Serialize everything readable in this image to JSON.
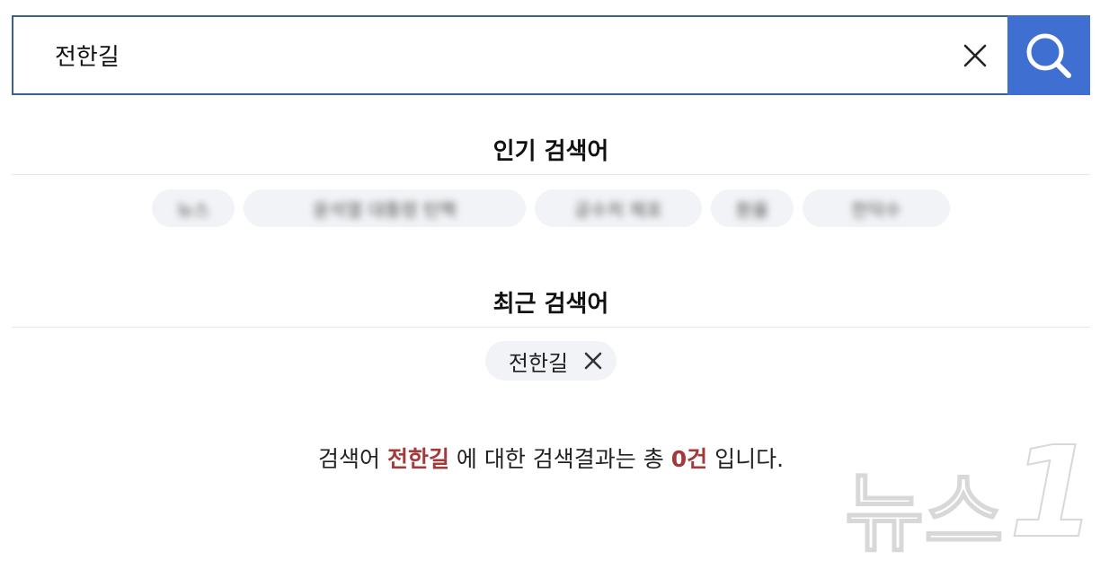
{
  "search": {
    "value": "전한길",
    "placeholder": ""
  },
  "icons": {
    "clear": "close-icon",
    "search": "search-icon",
    "remove_recent": "close-icon"
  },
  "colors": {
    "search_border": "#3b5f8f",
    "search_button": "#3f6fd1",
    "highlight": "#a33a3a",
    "chip_bg": "#f1f3f6"
  },
  "popular": {
    "title": "인기 검색어",
    "items": [
      {
        "label": "뉴스"
      },
      {
        "label": "윤석열 대통령 탄핵"
      },
      {
        "label": "공수처 체포"
      },
      {
        "label": "환율"
      },
      {
        "label": "한덕수"
      }
    ]
  },
  "recent": {
    "title": "최근 검색어",
    "items": [
      {
        "label": "전한길"
      }
    ]
  },
  "result": {
    "prefix": "검색어",
    "keyword": "전한길",
    "middle": "에 대한 검색결과는 총",
    "count": "0건",
    "suffix": "입니다."
  },
  "watermark": {
    "text": "뉴스",
    "mark": "1"
  }
}
